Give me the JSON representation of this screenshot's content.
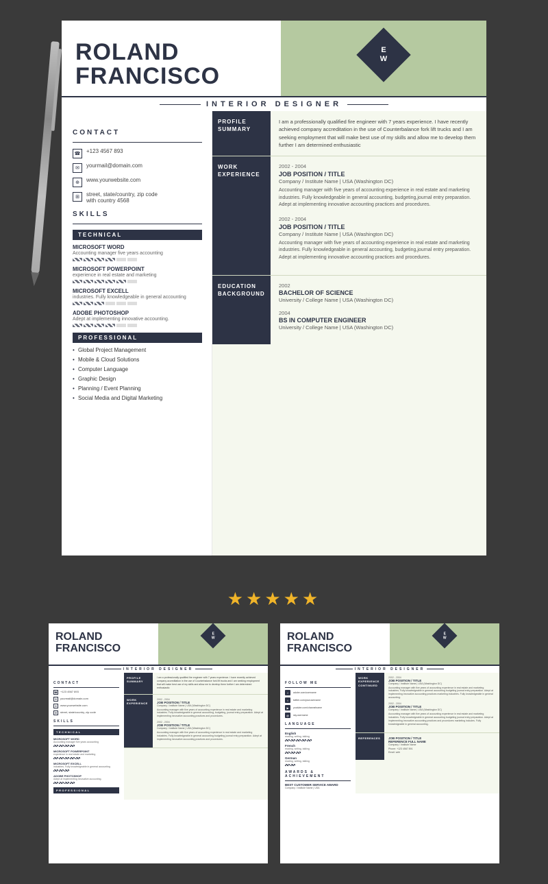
{
  "background": "#3a3a3a",
  "resume": {
    "name_line1": "ROLAND",
    "name_line2": "FRANCISCO",
    "job_title": "INTERIOR DESIGNER",
    "monogram_line1": "E",
    "monogram_line2": "W",
    "contact_section_title": "CONTACT",
    "contact_items": [
      {
        "icon": "☎",
        "text": "+123 4567 893"
      },
      {
        "icon": "✉",
        "text": "yourmail@domain.com"
      },
      {
        "icon": "🌐",
        "text": "www.yourwebsite.com"
      },
      {
        "icon": "📍",
        "text": "street, state/country, zip code\nwith country 4568"
      }
    ],
    "skills_section_title": "SKILLS",
    "technical_label": "TECHNICAL",
    "skills": [
      {
        "name": "MICROSOFT WORD",
        "desc": "Accounting manager five years accounting",
        "bars": 4,
        "total": 6
      },
      {
        "name": "MICROSOFT POWERPOINT",
        "desc": "experience in real estate and marketing",
        "bars": 5,
        "total": 6
      },
      {
        "name": "MICROSOFT EXCELL",
        "desc": "industries. Fully knowledgeable in general accounting",
        "bars": 3,
        "total": 6
      },
      {
        "name": "ADOBE PHOTOSHOP",
        "desc": "Adept at implementing innovative accounting.",
        "bars": 4,
        "total": 6
      }
    ],
    "professional_label": "PROFESSIONAL",
    "pro_skills": [
      "Global Project Management",
      "Mobile & Cloud Solutions",
      "Computer Language",
      "Graphic Design",
      "Planning / Event Planning",
      "Social Media and Digital Marketing"
    ],
    "profile_summary_label": "PROFILE\nSUMMARY",
    "profile_text": "I am a professionally qualified fire engineer with 7 years experience. I have recently achieved company accreditation in the use of Counterbalance fork lift trucks and I am seeking employment that will make best use of my skills and allow me to develop them further I am determined enthusiastic",
    "work_experience_label": "WORK\nEXPERIENCE",
    "jobs": [
      {
        "years": "2002 - 2004",
        "position": "JOB POSITION / TITLE",
        "company": "Company / Institute Name  |  USA (Washington DC)",
        "description": "Accounting manager with five years of accounting experience in real estate and marketing industries. Fully knowledgeable in general accounting, budgeting,journal entry preparation. Adept at implementing innovative accounting practices and procedures."
      },
      {
        "years": "2002 - 2004",
        "position": "JOB POSITION / TITLE",
        "company": "Company / Institute Name  |  USA (Washington DC)",
        "description": "Accounting manager with five years of accounting experience in real estate and marketing industries. Fully knowledgeable in general accounting, budgeting,journal entry preparation. Adept at implementing innovative accounting practices and procedures."
      }
    ],
    "education_label": "EDUCATION\nBACKGROUND",
    "education": [
      {
        "year": "2002",
        "degree": "BACHELOR OF SCIENCE",
        "school": "University / College Name  |  USA (Washington DC)"
      },
      {
        "year": "2004",
        "degree": "BS IN COMPUTER ENGINEER",
        "school": "University / College Name  |  USA (Washington DC)"
      }
    ]
  },
  "stars": "★★★★★",
  "preview_left": {
    "name_line1": "ROLAND",
    "name_line2": "FRANCISCO",
    "job_title": "INTERIOR DESIGNER",
    "monogram_line1": "E",
    "monogram_line2": "W"
  },
  "preview_right": {
    "name_line1": "ROLAND",
    "name_line2": "FRANCISCO",
    "job_title": "INTERIOR DESIGNER",
    "monogram_line1": "E",
    "monogram_line2": "W",
    "follow_label": "FOLLOW ME",
    "follow_items": [
      {
        "icon": "f",
        "text": "adobe.com/username"
      },
      {
        "icon": "t",
        "text": "twitter.com/yourusername"
      },
      {
        "icon": "▶",
        "text": "youtube.com/channelname"
      },
      {
        "icon": "@",
        "text": "sky.username"
      }
    ],
    "language_label": "LANGUAGE",
    "languages": [
      {
        "name": "English",
        "level": "reading, writing, talking"
      },
      {
        "name": "French",
        "level": "reading, writing, talking"
      },
      {
        "name": "German",
        "level": "reading, writing, talking"
      }
    ],
    "awards_label": "AWARDS &\nACHIEVEMENT",
    "awards": [
      {
        "title": "BEST CUSTOMER SERVICE AWARD",
        "text": "Company / Institute Name  |  USA"
      }
    ]
  }
}
